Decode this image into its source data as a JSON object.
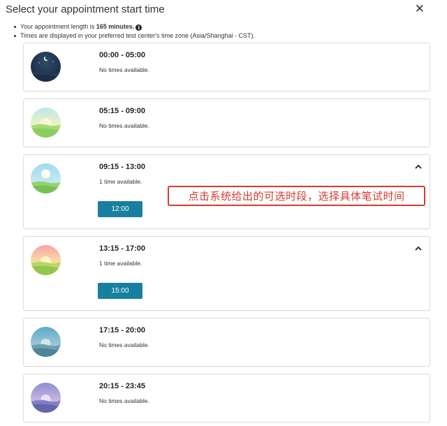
{
  "header": {
    "title": "Select your appointment start time",
    "close_label": "✕"
  },
  "info": {
    "length_prefix": "Your appointment length is ",
    "length_value": "165 minutes.",
    "timezone_note": "Times are displayed in your preferred test center's time zone (Asia/Shanghai - CST)."
  },
  "slots": [
    {
      "range": "00:00 - 05:00",
      "availability": "No times available.",
      "icon": "night-moon-icon"
    },
    {
      "range": "05:15 - 09:00",
      "availability": "No times available.",
      "icon": "sunrise-icon"
    },
    {
      "range": "09:15 - 13:00",
      "availability": "1 time available.",
      "time": "12:00",
      "icon": "morning-sun-icon"
    },
    {
      "range": "13:15 - 17:00",
      "availability": "1 time available.",
      "time": "15:00",
      "icon": "afternoon-sun-icon"
    },
    {
      "range": "17:15 - 20:00",
      "availability": "No times available.",
      "icon": "evening-icon"
    },
    {
      "range": "20:15 - 23:45",
      "availability": "No times available.",
      "icon": "dusk-icon"
    }
  ],
  "annotation": {
    "text": "点击系统给出的可选时段，选择具体笔试时间"
  },
  "colors": {
    "button": "#17809f",
    "annotation": "#d43b2f"
  }
}
